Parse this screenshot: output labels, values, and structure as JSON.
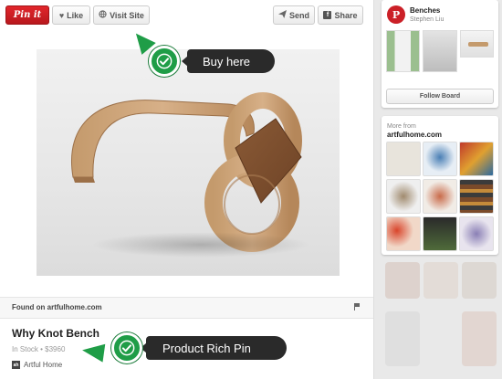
{
  "toolbar": {
    "pin_label": "Pin it",
    "like_label": "Like",
    "visit_label": "Visit Site",
    "send_label": "Send",
    "share_label": "Share"
  },
  "callouts": {
    "buy_here": "Buy here",
    "product_rich_pin": "Product Rich Pin"
  },
  "pin": {
    "found_on": "Found on artfulhome.com",
    "title": "Why Knot Bench",
    "stock_price": "In Stock • $3960",
    "merchant": "Artful Home",
    "merchant_logo": "ah"
  },
  "board": {
    "title": "Benches",
    "owner": "Stephen Liu",
    "follow_label": "Follow Board"
  },
  "more_from": {
    "label": "More from",
    "site": "artfulhome.com"
  },
  "colors": {
    "pinterest_red": "#cb2027",
    "callout_green": "#1f9d47",
    "callout_dark": "#2a2a2a"
  }
}
